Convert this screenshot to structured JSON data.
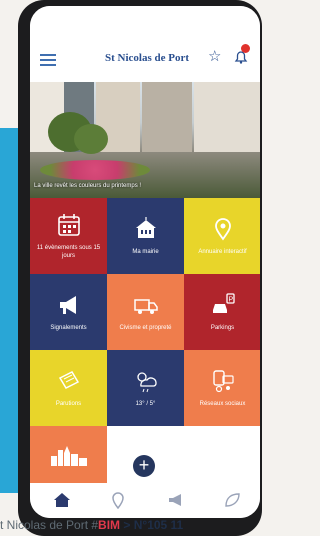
{
  "header": {
    "title": "St Nicolas de Port",
    "notification_count": ""
  },
  "hero": {
    "caption": "La ville revêt les couleurs du printemps !"
  },
  "tiles": [
    {
      "label": "11 évènements sous 15 jours",
      "color": "#b0252c",
      "icon": "calendar-icon"
    },
    {
      "label": "Ma mairie",
      "color": "#2b3a6e",
      "icon": "town-hall-icon"
    },
    {
      "label": "Annuaire interactif",
      "color": "#e8d52a",
      "icon": "map-pin-icon"
    },
    {
      "label": "Signalements",
      "color": "#2b3a6e",
      "icon": "megaphone-icon"
    },
    {
      "label": "Civisme et propreté",
      "color": "#ef7d4c",
      "icon": "recycling-truck-icon"
    },
    {
      "label": "Parkings",
      "color": "#b0252c",
      "icon": "parking-car-icon"
    },
    {
      "label": "Parutions",
      "color": "#e8d52a",
      "icon": "publication-icon"
    },
    {
      "label": "13° / 5°",
      "color": "#2b3a6e",
      "icon": "weather-icon"
    },
    {
      "label": "Réseaux sociaux",
      "color": "#ef7d4c",
      "icon": "social-network-icon"
    },
    {
      "label": "",
      "color": "#ef7d4c",
      "icon": "city-skyline-icon"
    }
  ],
  "nav": [
    "home-icon",
    "location-icon",
    "megaphone-icon",
    "leaf-icon"
  ],
  "footer": {
    "part1": "t Nicolas de Port #",
    "bim": "BIM",
    "part2": " > N°105 ",
    "page": "11"
  }
}
